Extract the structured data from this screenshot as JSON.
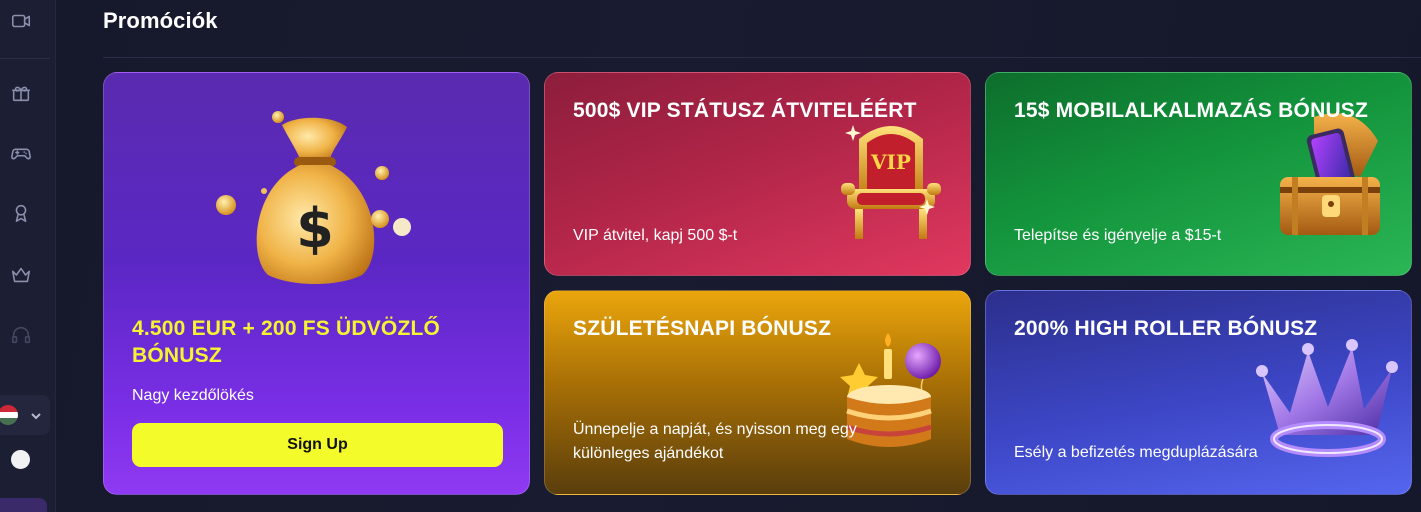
{
  "page": {
    "title": "Promóciók"
  },
  "sidebar": {
    "icons": [
      "video-icon",
      "gift-icon",
      "gamepad-icon",
      "award-icon",
      "crown-icon",
      "headset-icon"
    ],
    "language": {
      "flag": "hungary-flag-icon"
    }
  },
  "colors": {
    "accent_yellow": "#f3fb2a",
    "title_yellow": "#f4f430",
    "background": "#15172a"
  },
  "promotions": [
    {
      "title": "4.500 EUR + 200 FS ÜDVÖZLŐ BÓNUSZ",
      "description": "Nagy kezdőlökés",
      "button": "Sign Up",
      "image": "money-bag"
    },
    {
      "title": "500$ VIP STÁTUSZ ÁTVITELÉÉRT",
      "description": "VIP átvitel, kapj 500 $-t",
      "image": "vip-throne",
      "image_label": "VIP"
    },
    {
      "title": "15$ MOBILALKALMAZÁS BÓNUSZ",
      "description": "Telepítse és igényelje a $15-t",
      "image": "treasure-chest-phone"
    },
    {
      "title": "SZÜLETÉSNAPI BÓNUSZ",
      "description": "Ünnepelje a napját, és nyisson meg egy különleges ajándékot",
      "image": "birthday-cake"
    },
    {
      "title": "200% HIGH ROLLER BÓNUSZ",
      "description": "Esély a befizetés megduplázására",
      "image": "crystal-crown"
    }
  ]
}
